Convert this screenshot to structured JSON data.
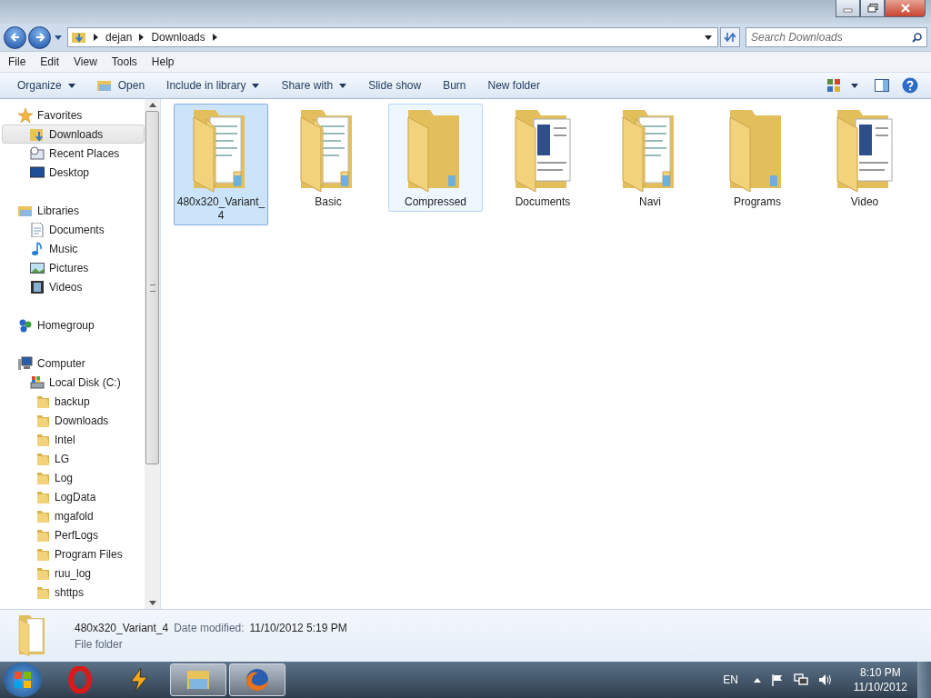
{
  "address": {
    "crumbs": [
      "dejan",
      "Downloads"
    ]
  },
  "search": {
    "placeholder": "Search Downloads"
  },
  "menu": [
    "File",
    "Edit",
    "View",
    "Tools",
    "Help"
  ],
  "toolbar": [
    {
      "label": "Organize",
      "kind": "dropdown"
    },
    {
      "label": "Open",
      "kind": "icon"
    },
    {
      "label": "Include in library",
      "kind": "dropdown"
    },
    {
      "label": "Share with",
      "kind": "dropdown"
    },
    {
      "label": "Slide show",
      "kind": "plain"
    },
    {
      "label": "Burn",
      "kind": "plain"
    },
    {
      "label": "New folder",
      "kind": "plain"
    }
  ],
  "sidebar": {
    "groups": [
      {
        "label": "Favorites",
        "kind": "star",
        "children": [
          {
            "label": "Downloads",
            "kind": "download",
            "selected": true
          },
          {
            "label": "Recent Places",
            "kind": "recent",
            "selected": false
          },
          {
            "label": "Desktop",
            "kind": "desktop",
            "selected": false
          }
        ]
      },
      {
        "label": "Libraries",
        "kind": "library",
        "children": [
          {
            "label": "Documents",
            "kind": "document",
            "selected": false
          },
          {
            "label": "Music",
            "kind": "music",
            "selected": false
          },
          {
            "label": "Pictures",
            "kind": "picture",
            "selected": false
          },
          {
            "label": "Videos",
            "kind": "video",
            "selected": false
          }
        ]
      },
      {
        "label": "Homegroup",
        "kind": "homegroup"
      },
      {
        "label": "Computer",
        "kind": "computer",
        "children": [
          {
            "label": "Local Disk (C:)",
            "kind": "disk",
            "selected": false,
            "children": [
              {
                "label": "backup",
                "kind": "folder",
                "selected": false
              },
              {
                "label": "Downloads",
                "kind": "folder",
                "selected": false
              },
              {
                "label": "Intel",
                "kind": "folder",
                "selected": false
              },
              {
                "label": "LG",
                "kind": "folder",
                "selected": false
              },
              {
                "label": "Log",
                "kind": "folder",
                "selected": false
              },
              {
                "label": "LogData",
                "kind": "folder",
                "selected": false
              },
              {
                "label": "mgafold",
                "kind": "folder",
                "selected": false
              },
              {
                "label": "PerfLogs",
                "kind": "folder",
                "selected": false
              },
              {
                "label": "Program Files",
                "kind": "folder",
                "selected": false
              },
              {
                "label": "ruu_log",
                "kind": "folder",
                "selected": false
              },
              {
                "label": "shttps",
                "kind": "folder",
                "selected": false
              }
            ]
          }
        ]
      }
    ]
  },
  "folders": [
    {
      "label": "480x320_Variant_4",
      "kind": "pages",
      "selected": true,
      "hovered": false
    },
    {
      "label": "Basic",
      "kind": "pages",
      "selected": false,
      "hovered": false
    },
    {
      "label": "Compressed",
      "kind": "plain",
      "selected": false,
      "hovered": true
    },
    {
      "label": "Documents",
      "kind": "sheet",
      "selected": false,
      "hovered": false
    },
    {
      "label": "Navi",
      "kind": "pages",
      "selected": false,
      "hovered": false
    },
    {
      "label": "Programs",
      "kind": "plain",
      "selected": false,
      "hovered": false
    },
    {
      "label": "Video",
      "kind": "sheet",
      "selected": false,
      "hovered": false
    }
  ],
  "details": {
    "name": "480x320_Variant_4",
    "field_label": "Date modified:",
    "field_value": "11/10/2012 5:19 PM",
    "type": "File folder"
  },
  "taskbar": {
    "apps": [
      {
        "kind": "opera",
        "active": false
      },
      {
        "kind": "winamp",
        "active": false
      },
      {
        "kind": "explorer",
        "active": true
      },
      {
        "kind": "firefox",
        "active": true
      }
    ],
    "language": "EN",
    "time": "8:10 PM",
    "date": "11/10/2012"
  }
}
